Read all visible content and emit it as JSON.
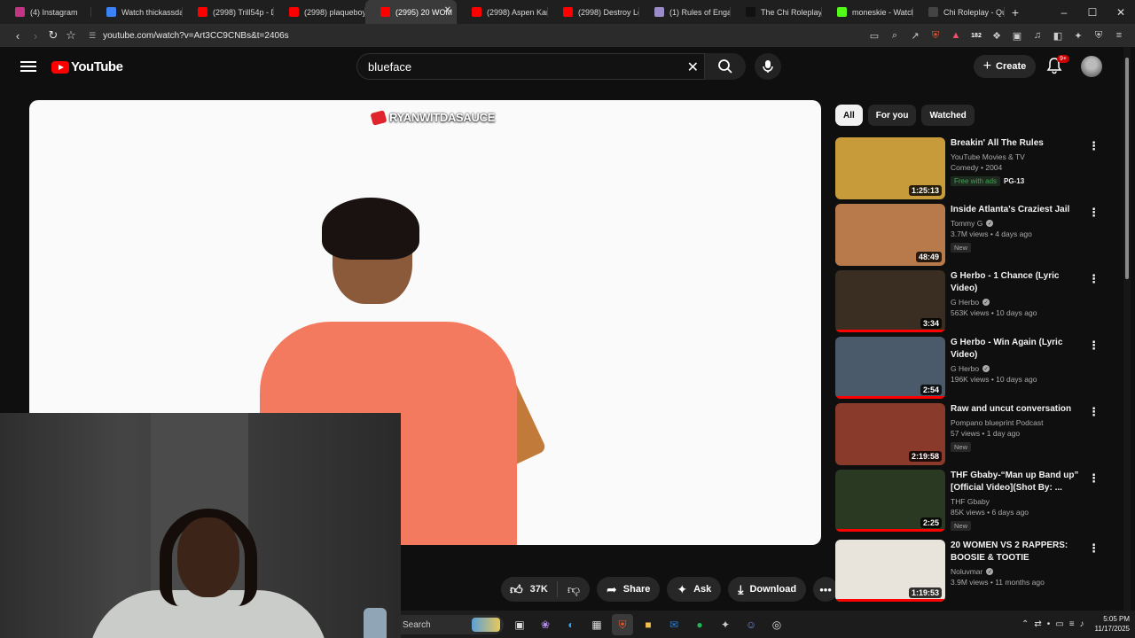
{
  "browser": {
    "tabs": [
      {
        "label": "(4) Instagram",
        "color": "#c13584"
      },
      {
        "label": "Watch thickassdaph",
        "color": "#3b82f6"
      },
      {
        "label": "(2998) Trill54p - Do",
        "color": "#ff0000"
      },
      {
        "label": "(2998) plaqueboym",
        "color": "#ff0000"
      },
      {
        "label": "(2995) 20 WOM",
        "color": "#ff0000",
        "active": true
      },
      {
        "label": "(2998) Aspen Karti",
        "color": "#ff0000"
      },
      {
        "label": "(2998) Destroy Lon",
        "color": "#ff0000"
      },
      {
        "label": "(1) Rules of Engage",
        "color": "#9b8cc9"
      },
      {
        "label": "The Chi Roleplay (@",
        "color": "#111111"
      },
      {
        "label": "moneskie - Watch",
        "color": "#53fc18"
      },
      {
        "label": "Chi Roleplay - Quee",
        "color": "#444444"
      }
    ],
    "url": "youtube.com/watch?v=Art3CC9CNBs&t=2406s",
    "badge_count": "182"
  },
  "youtube": {
    "logo_text": "YouTube",
    "search_value": "blueface",
    "create_label": "Create",
    "notif_badge": "9+",
    "watermark": "RYANWITDASAUCE",
    "actions": {
      "like_count": "37K",
      "share": "Share",
      "ask": "Ask",
      "download": "Download"
    },
    "chips": [
      "All",
      "For you",
      "Watched"
    ],
    "recommendations": [
      {
        "title": "Breakin' All The Rules",
        "channel": "YouTube Movies & TV",
        "meta": "Comedy • 2004",
        "badge": "Free with ads",
        "rating": "PG-13",
        "duration": "1:25:13",
        "thumb": "#c79a3a",
        "verified": false
      },
      {
        "title": "Inside Atlanta's Craziest Jail",
        "channel": "Tommy G",
        "meta": "3.7M views • 4 days ago",
        "badge": "New",
        "duration": "48:49",
        "thumb": "#b87a4a",
        "verified": true
      },
      {
        "title": "G Herbo - 1 Chance (Lyric Video)",
        "channel": "G Herbo",
        "meta": "563K views • 10 days ago",
        "duration": "3:34",
        "thumb": "#3a2e22",
        "verified": true,
        "progress": 100
      },
      {
        "title": "G Herbo - Win Again (Lyric Video)",
        "channel": "G Herbo",
        "meta": "196K views • 10 days ago",
        "duration": "2:54",
        "thumb": "#4a5a6a",
        "verified": true,
        "progress": 100
      },
      {
        "title": "Raw and uncut conversation",
        "channel": "Pompano blueprint Podcast",
        "meta": "57 views • 1 day ago",
        "badge": "New",
        "duration": "2:19:58",
        "thumb": "#8a3a2a",
        "verified": false
      },
      {
        "title": "THF Gbaby-“Man up Band up” [Official Video](Shot By: ...",
        "channel": "THF Gbaby",
        "meta": "85K views • 6 days ago",
        "badge": "New",
        "duration": "2:25",
        "thumb": "#2a3a22",
        "verified": false,
        "progress": 100
      },
      {
        "title": "20 WOMEN VS 2 RAPPERS: BOOSIE & TOOTIE",
        "channel": "Noluvmar",
        "meta": "3.9M views • 11 months ago",
        "duration": "1:19:53",
        "thumb": "#e8e4dc",
        "verified": true,
        "progress": 100
      }
    ]
  },
  "taskbar": {
    "search": "Search",
    "time": "5:05 PM",
    "date": "11/17/2025"
  }
}
